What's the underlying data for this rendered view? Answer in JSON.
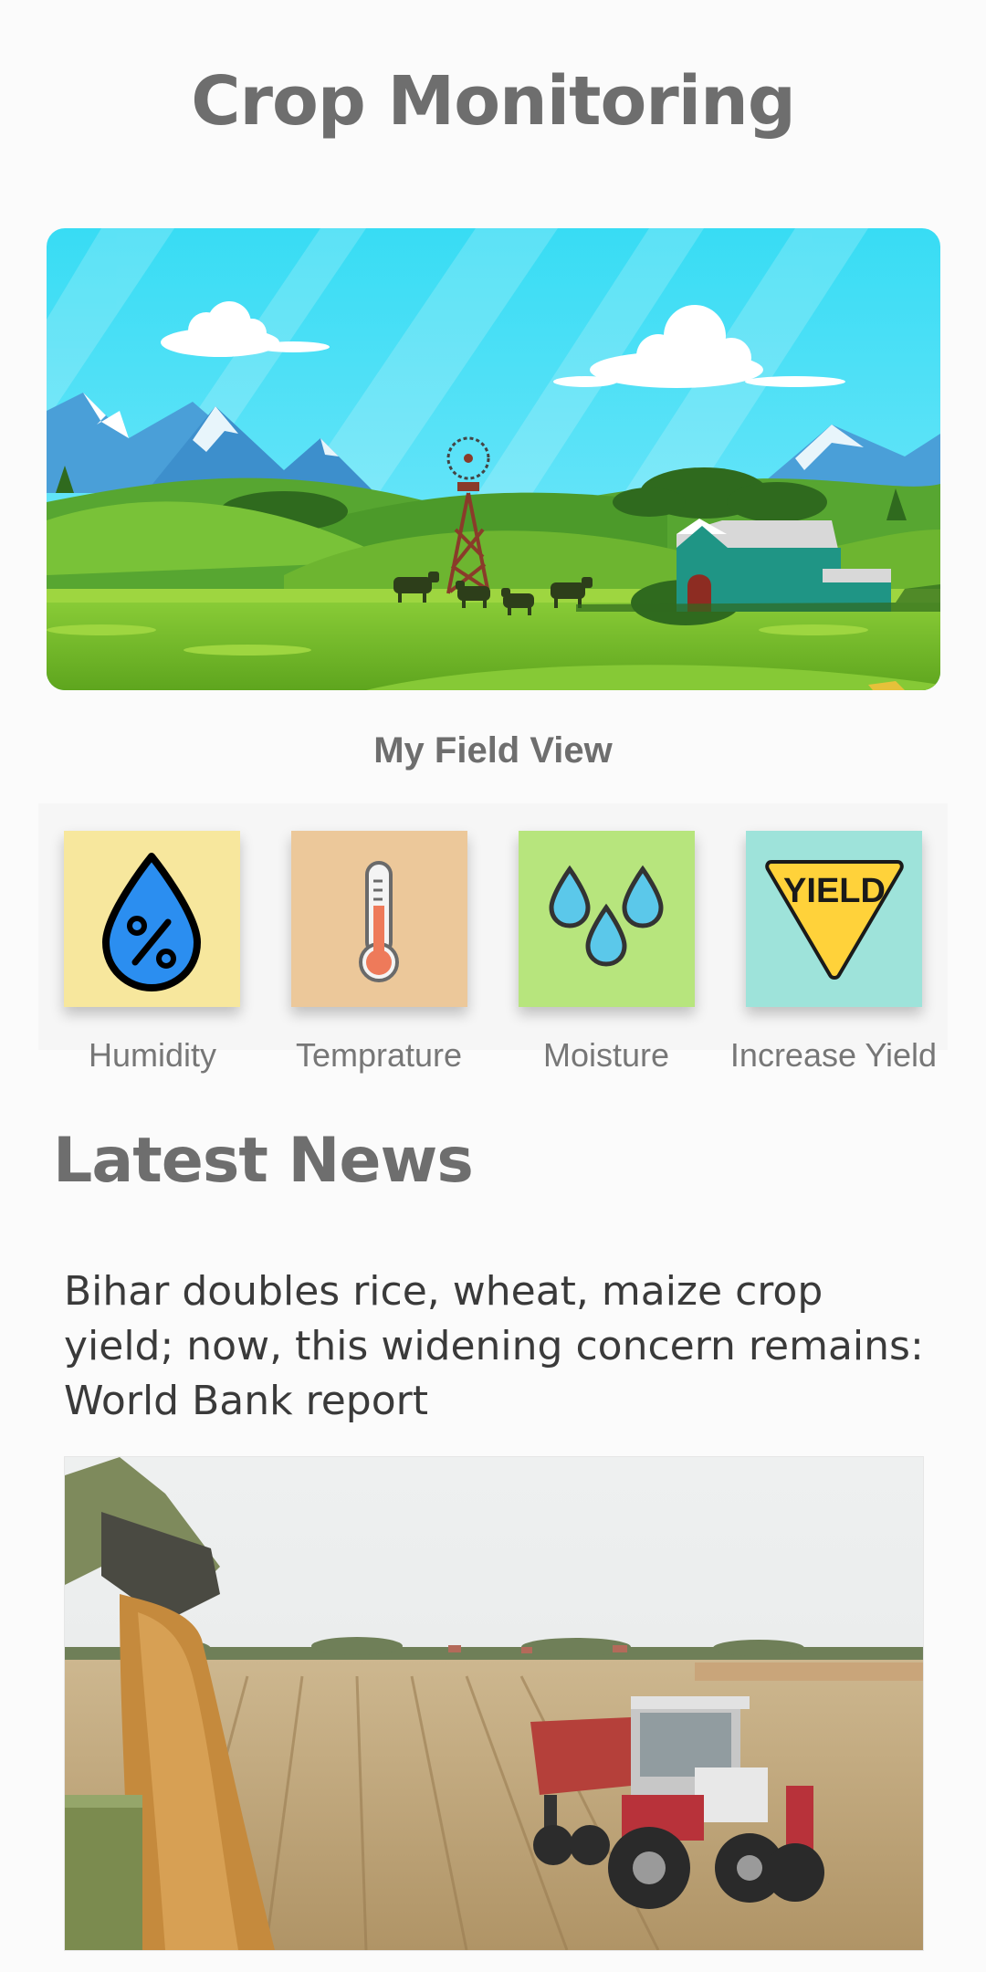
{
  "header": {
    "title": "Crop Monitoring"
  },
  "hero": {
    "caption": "My Field View",
    "image_icon": "farm-landscape-illustration"
  },
  "tiles": [
    {
      "label": "Humidity",
      "icon": "humidity-drop-icon",
      "color": "#f7e79d"
    },
    {
      "label": "Temprature",
      "icon": "thermometer-icon",
      "color": "#ecc89a"
    },
    {
      "label": "Moisture",
      "icon": "water-drops-icon",
      "color": "#b7e57d"
    },
    {
      "label": "Increase Yield",
      "icon": "yield-sign-icon",
      "color": "#9ee3da",
      "sign_text": "YIELD"
    }
  ],
  "news": {
    "section_title": "Latest News",
    "headline": "Bihar doubles rice, wheat, maize crop yield; now, this widening concern remains: World Bank report",
    "image_icon": "harvest-tractor-photo"
  }
}
